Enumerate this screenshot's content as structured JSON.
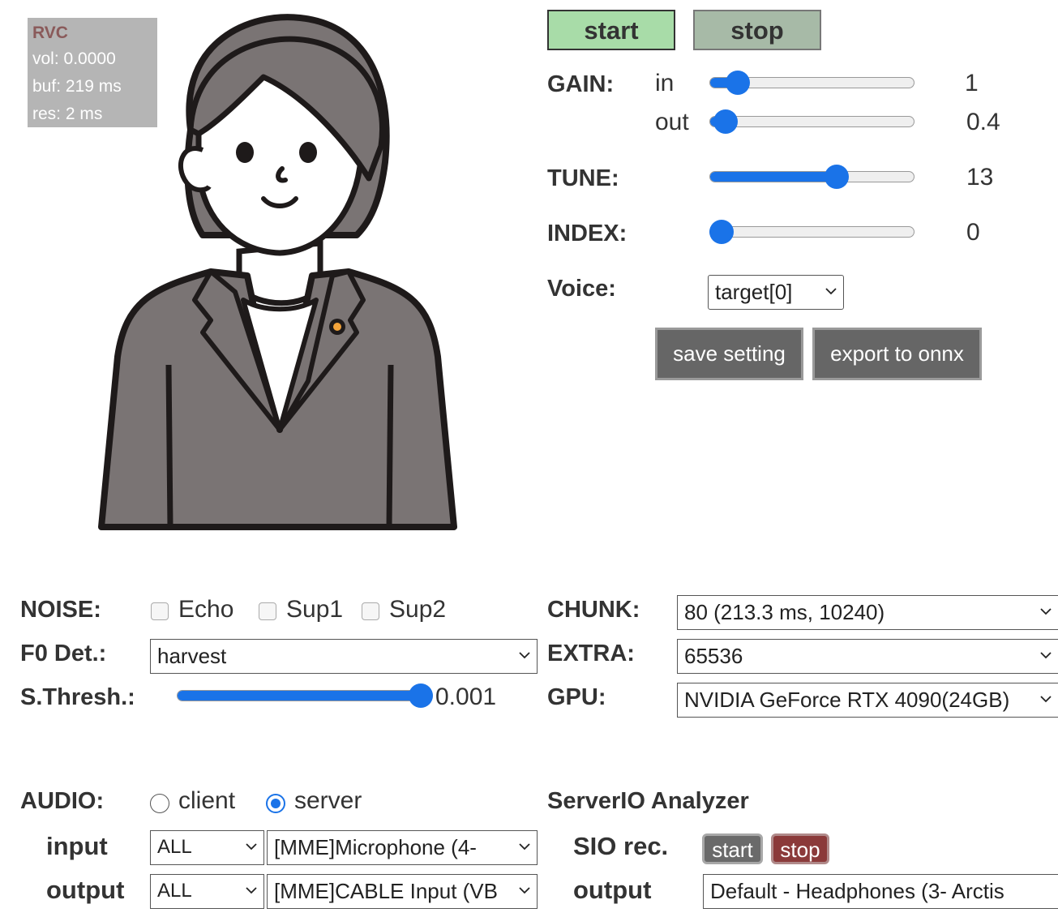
{
  "stats": {
    "title": "RVC",
    "vol": "vol: 0.0000",
    "buf": "buf: 219 ms",
    "res": "res: 2 ms"
  },
  "controls": {
    "start_label": "start",
    "stop_label": "stop",
    "gain_label": "GAIN:",
    "gain_in_label": "in",
    "gain_out_label": "out",
    "gain_in_value": "1",
    "gain_out_value": "0.4",
    "gain_in_level": 0.14,
    "gain_out_level": 0.08,
    "tune_label": "TUNE:",
    "tune_value": "13",
    "tune_level": 0.62,
    "index_label": "INDEX:",
    "index_value": "0",
    "index_level": 0.0,
    "voice_label": "Voice:",
    "voice_selected": "target[0]",
    "save_setting_label": "save setting",
    "export_onnx_label": "export to onnx"
  },
  "noise": {
    "label": "NOISE:",
    "options": [
      {
        "label": "Echo",
        "checked": false
      },
      {
        "label": "Sup1",
        "checked": false
      },
      {
        "label": "Sup2",
        "checked": false
      }
    ]
  },
  "f0": {
    "label": "F0 Det.:",
    "selected": "harvest"
  },
  "sthresh": {
    "label": "S.Thresh.:",
    "value": "0.001",
    "level": 1.0
  },
  "chunk": {
    "label": "CHUNK:",
    "selected": "80 (213.3 ms, 10240)"
  },
  "extra": {
    "label": "EXTRA:",
    "selected": "65536"
  },
  "gpu": {
    "label": "GPU:",
    "selected": "NVIDIA GeForce RTX 4090(24GB)"
  },
  "audio": {
    "label": "AUDIO:",
    "mode_client": "client",
    "mode_server": "server",
    "selected_mode": "server",
    "input_label": "input",
    "output_label": "output",
    "input_filter": "ALL",
    "input_device": "[MME]Microphone (4-",
    "output_filter": "ALL",
    "output_device": "[MME]CABLE Input (VB"
  },
  "analyzer": {
    "title": "ServerIO Analyzer",
    "sio_rec_label": "SIO rec.",
    "start_label": "start",
    "stop_label": "stop",
    "output_label": "output",
    "output_selected": "Default - Headphones (3- Arctis"
  },
  "colors": {
    "accent": "#1a73e8",
    "start_green": "#a8dca8",
    "stop_gray_green": "#a7baa7",
    "sio_stop": "#8b3a3a",
    "sio_start": "#6a6a6a"
  }
}
